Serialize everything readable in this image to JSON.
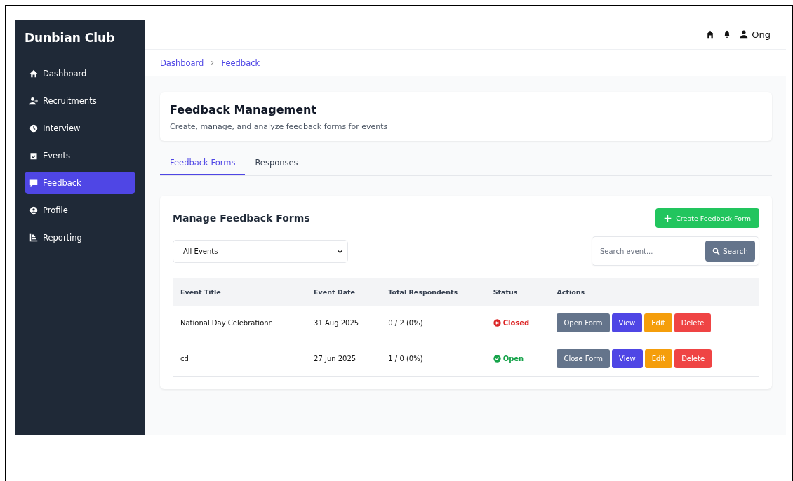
{
  "sidebar": {
    "brand": "Dunbian Club",
    "items": [
      {
        "label": "Dashboard",
        "selected": false
      },
      {
        "label": "Recruitments",
        "selected": false
      },
      {
        "label": "Interview",
        "selected": false
      },
      {
        "label": "Events",
        "selected": false
      },
      {
        "label": "Feedback",
        "selected": true
      },
      {
        "label": "Profile",
        "selected": false
      },
      {
        "label": "Reporting",
        "selected": false
      }
    ]
  },
  "header": {
    "user": "Ong"
  },
  "breadcrumb": [
    "Dashboard",
    "Feedback"
  ],
  "page": {
    "title": "Feedback Management",
    "subtitle": "Create, manage, and analyze feedback forms for events"
  },
  "tabs": [
    {
      "label": "Feedback Forms",
      "selected": true
    },
    {
      "label": "Responses",
      "selected": false
    }
  ],
  "panel": {
    "title": "Manage Feedback Forms",
    "create_button": "Create Feedback Form",
    "filter": {
      "value": "All Events"
    },
    "search": {
      "placeholder": "Search event...",
      "button": "Search"
    }
  },
  "table": {
    "columns": [
      "Event Title",
      "Event Date",
      "Total Respondents",
      "Status",
      "Actions"
    ],
    "rows": [
      {
        "title": "National Day Celebrationn",
        "date": "31 Aug 2025",
        "respondents": "0 / 2 (0%)",
        "status": {
          "kind": "closed",
          "label": "Closed"
        },
        "actions": [
          {
            "kind": "toggle",
            "label": "Open Form"
          },
          {
            "kind": "view",
            "label": "View"
          },
          {
            "kind": "edit",
            "label": "Edit"
          },
          {
            "kind": "delete",
            "label": "Delete"
          }
        ]
      },
      {
        "title": "cd",
        "date": "27 Jun 2025",
        "respondents": "1 / 0 (0%)",
        "status": {
          "kind": "open",
          "label": "Open"
        },
        "actions": [
          {
            "kind": "toggle",
            "label": "Close Form"
          },
          {
            "kind": "view",
            "label": "View"
          },
          {
            "kind": "edit",
            "label": "Edit"
          },
          {
            "kind": "delete",
            "label": "Delete"
          }
        ]
      }
    ]
  }
}
